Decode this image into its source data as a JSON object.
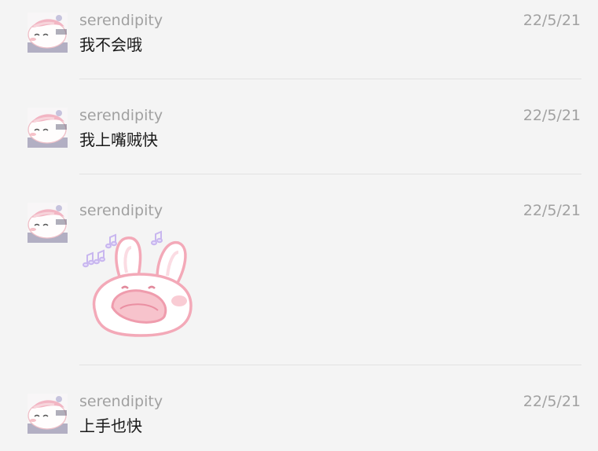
{
  "messages": [
    {
      "sender": "serendipity",
      "time": "22/5/21",
      "text": "我不会哦",
      "avatar": "pink-cat-avatar"
    },
    {
      "sender": "serendipity",
      "time": "22/5/21",
      "text": "我上嘴贼快",
      "avatar": "pink-cat-avatar"
    },
    {
      "sender": "serendipity",
      "time": "22/5/21",
      "sticker": "shouting-pink-bunny-sticker",
      "avatar": "pink-cat-avatar"
    },
    {
      "sender": "serendipity",
      "time": "22/5/21",
      "text": "上手也快",
      "avatar": "pink-cat-avatar"
    }
  ],
  "colors": {
    "background": "#f4f4f4",
    "meta_text": "#a1a1a1",
    "message_text": "#191919",
    "divider": "#e2e2e2",
    "sticker_pink": "#f3a9b8",
    "sticker_music_notes": "#c8b6ef"
  }
}
